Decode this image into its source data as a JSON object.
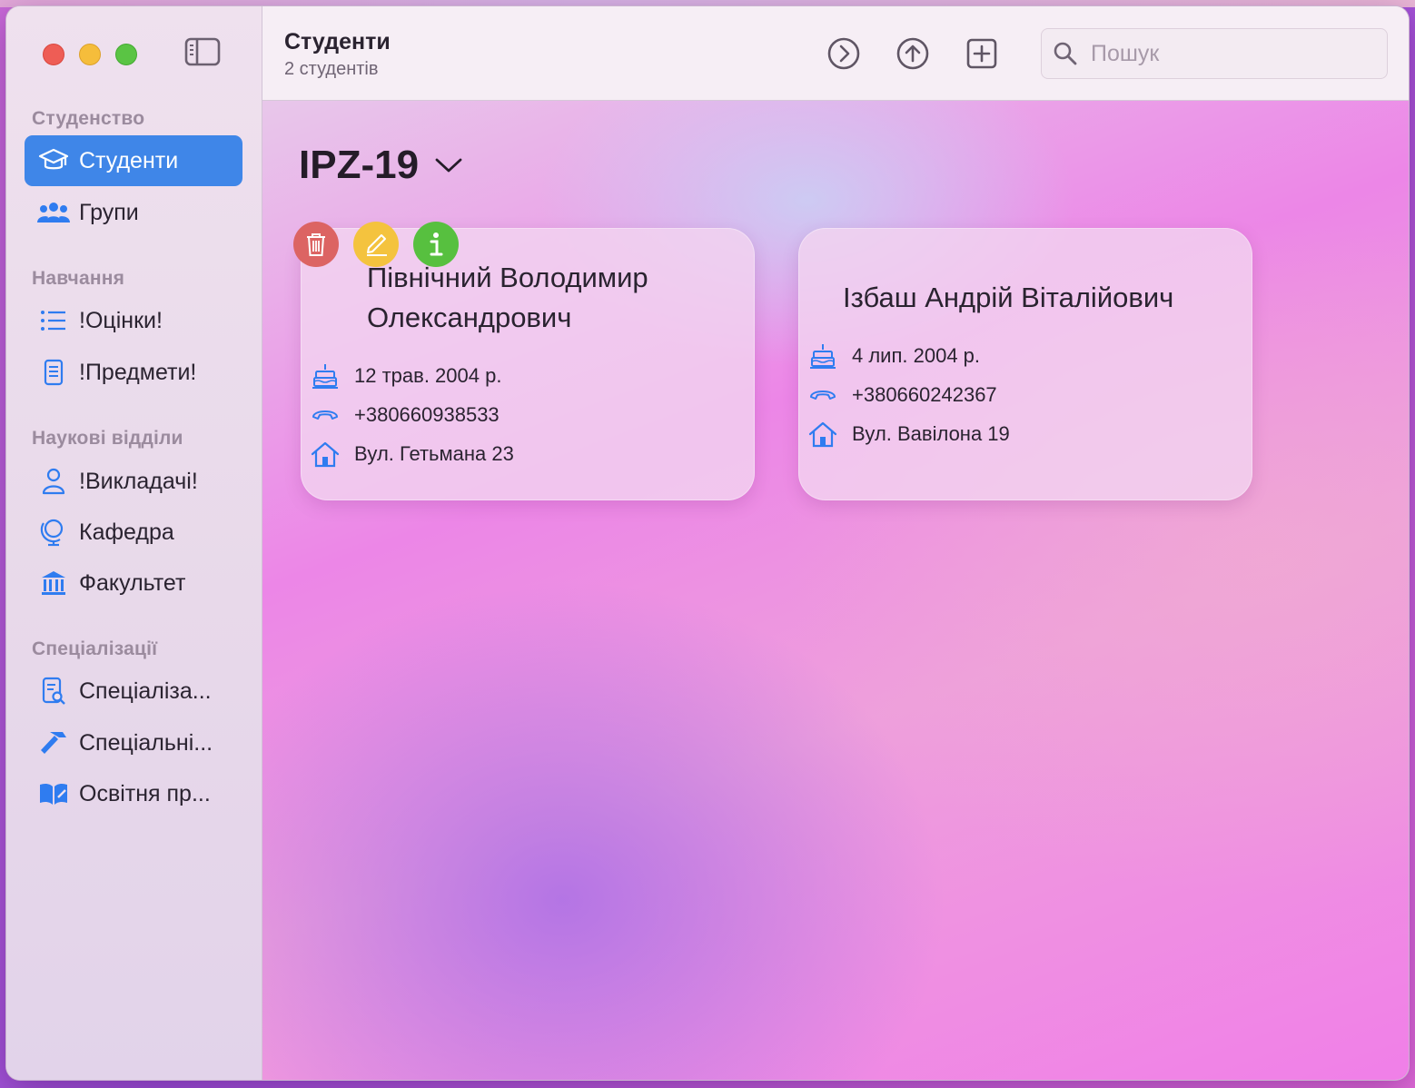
{
  "sidebar": {
    "sections": [
      {
        "title": "Студенство",
        "items": [
          {
            "label": "Студенти",
            "icon": "graduation-cap-icon",
            "active": true
          },
          {
            "label": "Групи",
            "icon": "people-icon",
            "active": false
          }
        ]
      },
      {
        "title": "Навчання",
        "items": [
          {
            "label": "!Оцінки!",
            "icon": "list-icon",
            "active": false
          },
          {
            "label": "!Предмети!",
            "icon": "document-icon",
            "active": false
          }
        ]
      },
      {
        "title": "Наукові відділи",
        "items": [
          {
            "label": "!Викладачі!",
            "icon": "person-icon",
            "active": false
          },
          {
            "label": "Кафедра",
            "icon": "globe-icon",
            "active": false
          },
          {
            "label": "Факультет",
            "icon": "building-columns-icon",
            "active": false
          }
        ]
      },
      {
        "title": "Спеціалізації",
        "items": [
          {
            "label": "Спеціаліза...",
            "icon": "document-search-icon",
            "active": false
          },
          {
            "label": "Спеціальні...",
            "icon": "hammer-icon",
            "active": false
          },
          {
            "label": "Освітня пр...",
            "icon": "book-icon",
            "active": false
          }
        ]
      }
    ]
  },
  "toolbar": {
    "title": "Студенти",
    "subtitle": "2 студентів",
    "search_placeholder": "Пошук"
  },
  "content": {
    "group_title": "IPZ-19",
    "students": [
      {
        "name_line1": "Північний Володимир",
        "name_line2": "Олександрович",
        "birthday": "12 трав. 2004 р.",
        "phone": "+380660938533",
        "address": "Вул. Гетьмана 23"
      },
      {
        "name_line1": "Ізбаш Андрій Віталійович",
        "birthday": "4 лип. 2004 р.",
        "phone": "+380660242367",
        "address": "Вул. Вавілона 19"
      }
    ]
  },
  "colors": {
    "accent": "#3f86e8",
    "icon_blue": "#2f7cf0",
    "delete": "#dc6463",
    "edit": "#f4c33e",
    "info": "#57c03f"
  }
}
